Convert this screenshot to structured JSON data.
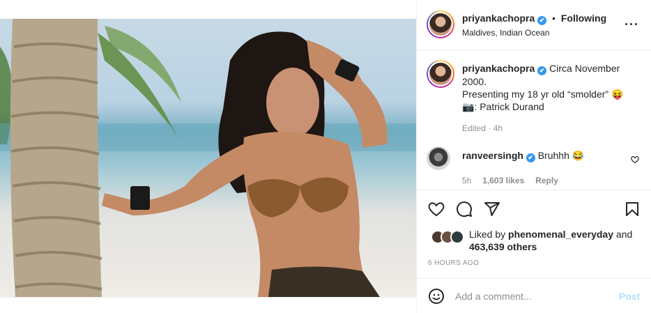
{
  "post": {
    "username": "priyankachopra",
    "verified_badge": "✔",
    "separator": "•",
    "follow_status": "Following",
    "location": "Maldives, Indian Ocean",
    "more_icon": "···"
  },
  "caption": {
    "username": "priyankachopra",
    "line1": "Circa November 2000.",
    "line2": "Presenting my 18 yr old “smolder” 😝",
    "line3": "📷: Patrick Durand",
    "edited": "Edited · 4h"
  },
  "comment": {
    "username": "ranveersingh",
    "text": "Bruhhh 😂",
    "time": "5h",
    "likes": "1,603 likes",
    "reply": "Reply"
  },
  "likes": {
    "prefix": "Liked by ",
    "user": "phenomenal_everyday",
    "and": " and",
    "others": "463,639 others"
  },
  "timestamp": "6 HOURS AGO",
  "add_comment": {
    "placeholder": "Add a comment...",
    "post_label": "Post"
  },
  "colors": {
    "verified": "#3897f0",
    "post_disabled": "#b2dffc",
    "muted": "#8e8e8e"
  },
  "icons": [
    "heart-icon",
    "comment-icon",
    "share-icon",
    "bookmark-icon",
    "emoji-icon",
    "more-options-icon"
  ]
}
